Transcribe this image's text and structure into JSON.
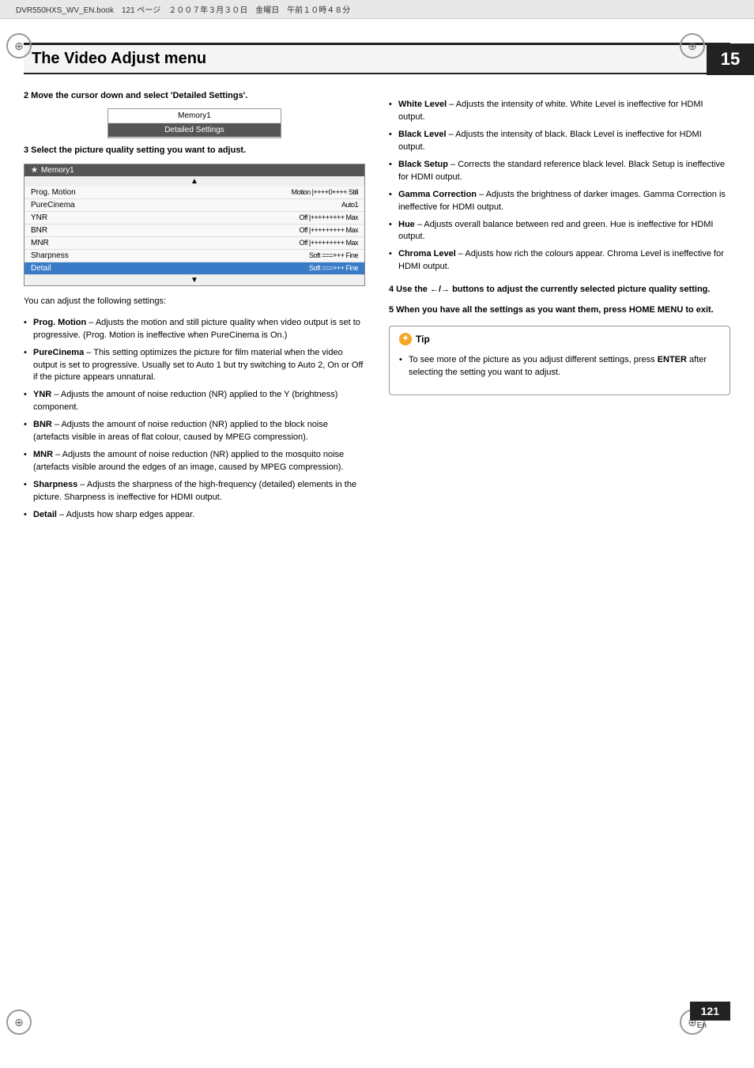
{
  "header": {
    "filepath": "DVR550HXS_WV_EN.book　121 ページ　２００７年３月３０日　金曜日　午前１０時４８分"
  },
  "chapter": {
    "number": "15"
  },
  "title": "The Video Adjust menu",
  "left_col": {
    "step2": {
      "heading": "2   Move the cursor down and select 'Detailed Settings'.",
      "menu": {
        "item1": "Memory1",
        "item2": "Detailed Settings"
      }
    },
    "step3": {
      "heading": "3   Select the picture quality setting you want to adjust.",
      "panel_title": "Memory1",
      "panel_icon": "★",
      "arrow_up": "▲",
      "arrow_down": "▼",
      "rows": [
        {
          "label": "Prog. Motion",
          "value": "Motion |++++0++++ Still",
          "highlighted": false
        },
        {
          "label": "PureCinema",
          "value": "Auto1",
          "highlighted": false
        },
        {
          "label": "YNR",
          "value": "Off |+++++++++ Max",
          "highlighted": false
        },
        {
          "label": "BNR",
          "value": "Off |+++++++++ Max",
          "highlighted": false
        },
        {
          "label": "MNR",
          "value": "Off |+++++++++ Max",
          "highlighted": false
        },
        {
          "label": "Sharpness",
          "value": "Soft ===+++ Fine",
          "highlighted": false
        },
        {
          "label": "Detail",
          "value": "Soft ===+++ Fine",
          "highlighted": true
        }
      ]
    },
    "body_text": "You can adjust the following settings:",
    "bullets": [
      {
        "term": "Prog. Motion",
        "text": " – Adjusts the motion and still picture quality when video output is set to progressive. (Prog. Motion is ineffective when PureCinema is On.)"
      },
      {
        "term": "PureCinema",
        "text": " – This setting optimizes the picture for film material when the video output is set to progressive. Usually set to Auto 1 but try switching to Auto 2, On or Off if the picture appears unnatural."
      },
      {
        "term": "YNR",
        "text": " – Adjusts the amount of noise reduction (NR) applied to the Y (brightness) component."
      },
      {
        "term": "BNR",
        "text": " – Adjusts the amount of noise reduction (NR) applied to the block noise (artefacts visible in areas of flat colour, caused by MPEG compression)."
      },
      {
        "term": "MNR",
        "text": " – Adjusts the amount of noise reduction (NR) applied to the mosquito noise (artefacts visible around the edges of an image, caused by MPEG compression)."
      },
      {
        "term": "Sharpness",
        "text": " – Adjusts the sharpness of the high-frequency (detailed) elements in the picture. Sharpness is ineffective for HDMI output."
      },
      {
        "term": "Detail",
        "text": " – Adjusts how sharp edges appear."
      }
    ]
  },
  "right_col": {
    "bullets": [
      {
        "term": "White Level",
        "text": " – Adjusts the intensity of white. White Level is ineffective for HDMI output."
      },
      {
        "term": "Black Level",
        "text": " – Adjusts the intensity of black. Black Level is ineffective for HDMI output."
      },
      {
        "term": "Black Setup",
        "text": " – Corrects the standard reference black level. Black Setup is ineffective for HDMI output."
      },
      {
        "term": "Gamma Correction",
        "text": " – Adjusts the brightness of darker images. Gamma Correction is ineffective for HDMI output."
      },
      {
        "term": "Hue",
        "text": " – Adjusts overall balance between red and green. Hue is ineffective for HDMI output."
      },
      {
        "term": "Chroma Level",
        "text": " – Adjusts how rich the colours appear. Chroma Level is ineffective for HDMI output."
      }
    ],
    "step4": "4   Use the ←/→ buttons to adjust the currently selected picture quality setting.",
    "step5": "5   When you have all the settings as you want them, press HOME MENU to exit.",
    "tip": {
      "title": "Tip",
      "icon": "✦",
      "bullets": [
        {
          "text": "To see more of the picture as you adjust different settings, press ENTER after selecting the setting you want to adjust."
        }
      ]
    }
  },
  "page_number": "121",
  "page_sub": "En",
  "deco": {
    "tl": "⊕",
    "tr": "⊕",
    "bl": "⊕",
    "br": "⊕"
  }
}
